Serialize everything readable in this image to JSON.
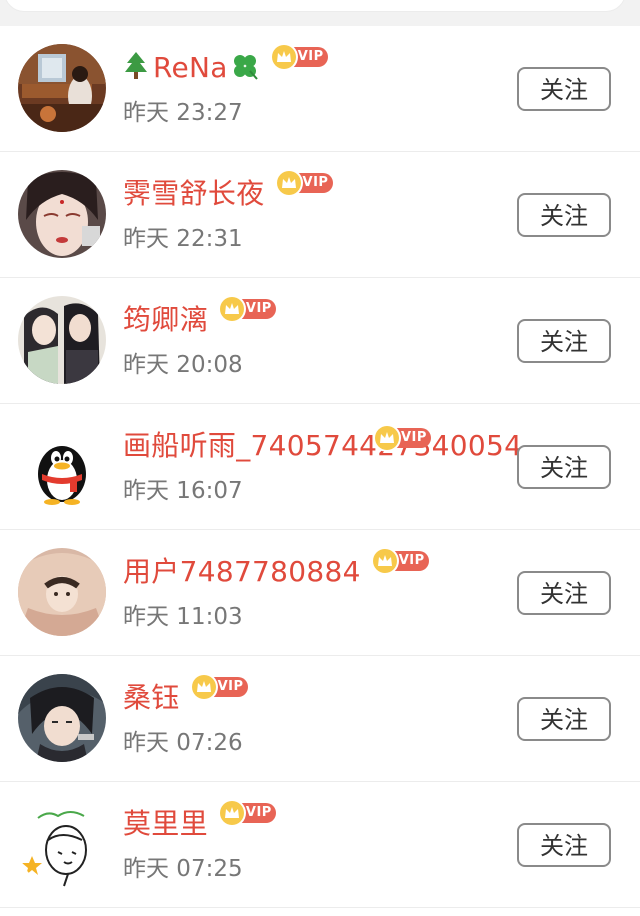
{
  "list": {
    "items": [
      {
        "name": "ReNa",
        "prefix_icon": "tree-icon",
        "suffix_icon": "four-leaf-clover-icon",
        "time": "昨天 23:27",
        "badge": "VIP",
        "action": "关注"
      },
      {
        "name": "霁雪舒长夜",
        "time": "昨天 22:31",
        "badge": "VIP",
        "action": "关注"
      },
      {
        "name": "筠卿漓",
        "time": "昨天 20:08",
        "badge": "VIP",
        "action": "关注"
      },
      {
        "name": "画船听雨_740574427340054",
        "time": "昨天 16:07",
        "badge": "VIP",
        "action": "关注"
      },
      {
        "name": "用户7487780884",
        "time": "昨天 11:03",
        "badge": "VIP",
        "action": "关注"
      },
      {
        "name": "桑钰",
        "time": "昨天 07:26",
        "badge": "VIP",
        "action": "关注"
      },
      {
        "name": "莫里里",
        "time": "昨天 07:25",
        "badge": "VIP",
        "action": "关注"
      }
    ]
  },
  "colors": {
    "name": "#e04a3c",
    "vip_pill": "#e86455",
    "crown": "#f7c94a",
    "time": "#777777",
    "button_border": "#8a8a8a"
  }
}
